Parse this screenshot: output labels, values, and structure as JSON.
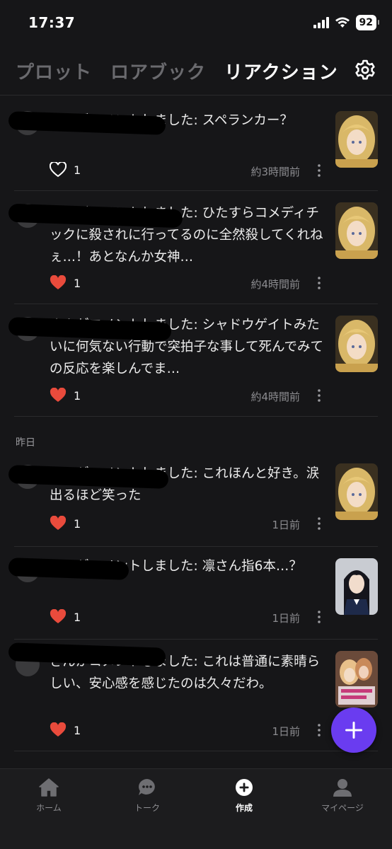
{
  "status": {
    "time": "17:37",
    "battery": "92"
  },
  "tabs": [
    {
      "label": "プロット",
      "active": false
    },
    {
      "label": "ロアブック",
      "active": false
    },
    {
      "label": "リアクション",
      "active": true
    }
  ],
  "icons": {
    "settings": "gear-icon",
    "like": "heart-icon",
    "more": "more-vertical-icon",
    "add": "plus-icon"
  },
  "colors": {
    "accent": "#6a3cf0",
    "like": "#e94b3c",
    "background": "#161618"
  },
  "section_yesterday": "昨日",
  "notifications": [
    {
      "comment": "さんがコメントしました: スペランカー？",
      "likes": "1",
      "liked": false,
      "time": "約3時間前"
    },
    {
      "comment": "さんがコメントしました: ひたすらコメディチックに殺されに行ってるのに全然殺してくれねぇ…！あとなんか女神…",
      "likes": "1",
      "liked": true,
      "time": "約4時間前"
    },
    {
      "comment": "さんがコメントしました: シャドウゲイトみたいに何気ない行動で突拍子な事して死んでみての反応を楽しんでま…",
      "likes": "1",
      "liked": true,
      "time": "約4時間前"
    },
    {
      "comment": "さんがコメントしました: これほんと好き。涙出るほど笑った",
      "likes": "1",
      "liked": true,
      "time": "1日前"
    },
    {
      "comment": "さんがコメントしました: 凛さん指6本…？",
      "likes": "1",
      "liked": true,
      "time": "1日前"
    },
    {
      "comment": "さんがコメントしました: これは普通に素晴らしい、安心感を感じたのは久々だわ。",
      "likes": "1",
      "liked": true,
      "time": "1日前"
    }
  ],
  "bottom_nav": [
    {
      "label": "ホーム",
      "icon": "home-icon"
    },
    {
      "label": "トーク",
      "icon": "chat-icon"
    },
    {
      "label": "作成",
      "icon": "create-icon",
      "active": true
    },
    {
      "label": "マイページ",
      "icon": "profile-icon"
    }
  ]
}
